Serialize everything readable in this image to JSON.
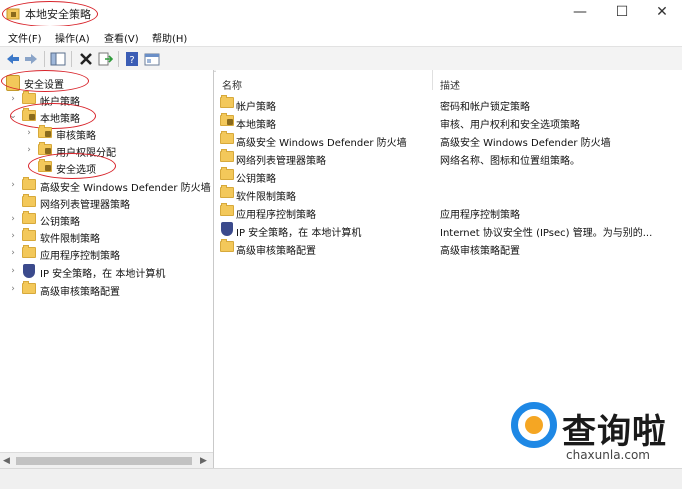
{
  "window": {
    "title": "本地安全策略",
    "controls": {
      "minimize": "—",
      "maximize": "☐",
      "close": "✕"
    }
  },
  "menu": [
    "文件(F)",
    "操作(A)",
    "查看(V)",
    "帮助(H)"
  ],
  "toolbar": {
    "icons": [
      "back-arrow-icon",
      "forward-arrow-icon",
      "show-hide-tree-icon",
      "delete-icon",
      "export-list-icon",
      "help-icon",
      "properties-icon"
    ]
  },
  "tree": {
    "root": "安全设置",
    "items": [
      {
        "label": "帐户策略",
        "expander": "›"
      },
      {
        "label": "本地策略",
        "expander": "⌄"
      },
      {
        "label": "审核策略",
        "expander": "›"
      },
      {
        "label": "用户权限分配",
        "expander": "›"
      },
      {
        "label": "安全选项",
        "expander": ""
      },
      {
        "label": "高级安全 Windows Defender 防火墙",
        "expander": "›"
      },
      {
        "label": "网络列表管理器策略",
        "expander": ""
      },
      {
        "label": "公钥策略",
        "expander": "›"
      },
      {
        "label": "软件限制策略",
        "expander": "›"
      },
      {
        "label": "应用程序控制策略",
        "expander": "›"
      },
      {
        "label": "IP 安全策略，在 本地计算机",
        "expander": "›"
      },
      {
        "label": "高级审核策略配置",
        "expander": "›"
      }
    ]
  },
  "list": {
    "columns": {
      "name": "名称",
      "description": "描述"
    },
    "rows": [
      {
        "name": "帐户策略",
        "description": "密码和帐户锁定策略"
      },
      {
        "name": "本地策略",
        "description": "审核、用户权利和安全选项策略"
      },
      {
        "name": "高级安全 Windows Defender 防火墙",
        "description": "高级安全 Windows Defender 防火墙"
      },
      {
        "name": "网络列表管理器策略",
        "description": "网络名称、图标和位置组策略。"
      },
      {
        "name": "公钥策略",
        "description": ""
      },
      {
        "name": "软件限制策略",
        "description": ""
      },
      {
        "name": "应用程序控制策略",
        "description": "应用程序控制策略"
      },
      {
        "name": "IP 安全策略，在 本地计算机",
        "description": "Internet 协议安全性 (IPsec) 管理。为与别的..."
      },
      {
        "name": "高级审核策略配置",
        "description": "高级审核策略配置"
      }
    ]
  },
  "watermark": {
    "name": "查询啦",
    "url": "chaxunla.com"
  },
  "colors": {
    "folder": "#f3c85a",
    "annotation": "#d8232a",
    "watermark_blue": "#1e88e5",
    "watermark_orange": "#f5a623"
  }
}
